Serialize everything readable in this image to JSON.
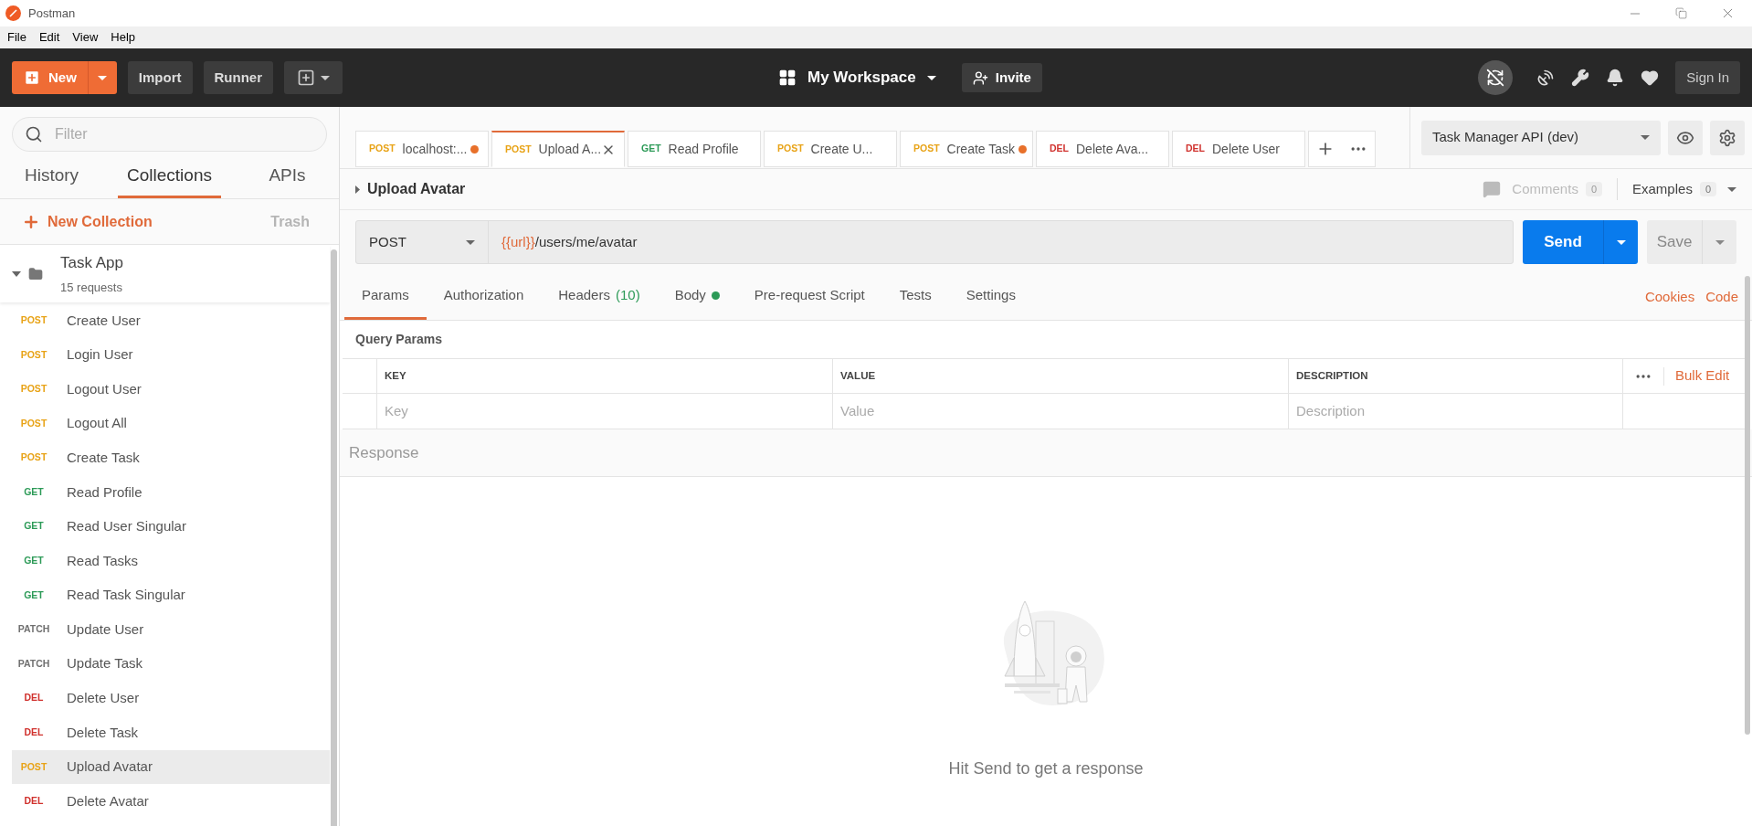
{
  "window": {
    "title": "Postman"
  },
  "menu": [
    "File",
    "Edit",
    "View",
    "Help"
  ],
  "header": {
    "new_button": "New",
    "import_button": "Import",
    "runner_button": "Runner",
    "workspace": "My Workspace",
    "invite_button": "Invite",
    "sign_in_button": "Sign In"
  },
  "sidebar": {
    "filter_placeholder": "Filter",
    "tabs": [
      {
        "label": "History",
        "selected": false
      },
      {
        "label": "Collections",
        "selected": true
      },
      {
        "label": "APIs",
        "selected": false
      }
    ],
    "new_collection": "New Collection",
    "trash": "Trash",
    "collection": {
      "name": "Task App",
      "count": "15 requests",
      "expanded": true,
      "requests": [
        {
          "method": "POST",
          "kind": "post",
          "name": "Create User",
          "selected": false
        },
        {
          "method": "POST",
          "kind": "post",
          "name": "Login User",
          "selected": false
        },
        {
          "method": "POST",
          "kind": "post",
          "name": "Logout User",
          "selected": false
        },
        {
          "method": "POST",
          "kind": "post",
          "name": "Logout All",
          "selected": false
        },
        {
          "method": "POST",
          "kind": "post",
          "name": "Create Task",
          "selected": false
        },
        {
          "method": "GET",
          "kind": "get",
          "name": "Read Profile",
          "selected": false
        },
        {
          "method": "GET",
          "kind": "get",
          "name": "Read User Singular",
          "selected": false
        },
        {
          "method": "GET",
          "kind": "get",
          "name": "Read Tasks",
          "selected": false
        },
        {
          "method": "GET",
          "kind": "get",
          "name": "Read Task Singular",
          "selected": false
        },
        {
          "method": "PATCH",
          "kind": "patch",
          "name": "Update User",
          "selected": false
        },
        {
          "method": "PATCH",
          "kind": "patch",
          "name": "Update Task",
          "selected": false
        },
        {
          "method": "DEL",
          "kind": "del",
          "name": "Delete User",
          "selected": false
        },
        {
          "method": "DEL",
          "kind": "del",
          "name": "Delete Task",
          "selected": false
        },
        {
          "method": "POST",
          "kind": "post",
          "name": "Upload Avatar",
          "selected": true
        },
        {
          "method": "DEL",
          "kind": "del",
          "name": "Delete Avatar",
          "selected": false
        }
      ]
    }
  },
  "request_tabs": [
    {
      "method": "POST",
      "kind": "post",
      "name": "localhost:...",
      "selected": false,
      "unsaved": true
    },
    {
      "method": "POST",
      "kind": "post",
      "name": "Upload A...",
      "selected": true,
      "unsaved": false
    },
    {
      "method": "GET",
      "kind": "get",
      "name": "Read Profile",
      "selected": false,
      "unsaved": false
    },
    {
      "method": "POST",
      "kind": "post",
      "name": "Create U...",
      "selected": false,
      "unsaved": false
    },
    {
      "method": "POST",
      "kind": "post",
      "name": "Create Task",
      "selected": false,
      "unsaved": true
    },
    {
      "method": "DEL",
      "kind": "del",
      "name": "Delete Ava...",
      "selected": false,
      "unsaved": false
    },
    {
      "method": "DEL",
      "kind": "del",
      "name": "Delete User",
      "selected": false,
      "unsaved": false
    }
  ],
  "environment": {
    "name": "Task Manager API (dev)"
  },
  "request": {
    "name": "Upload Avatar",
    "comments_label": "Comments",
    "comments_count": "0",
    "examples_label": "Examples",
    "examples_count": "0",
    "method": "POST",
    "url_variable": "{{url}}",
    "url_path": "/users/me/avatar",
    "send_button": "Send",
    "save_button": "Save",
    "tabs": [
      {
        "label": "Params",
        "selected": true
      },
      {
        "label": "Authorization",
        "selected": false
      },
      {
        "label": "Headers",
        "count": "(10)",
        "selected": false
      },
      {
        "label": "Body",
        "dot": true,
        "selected": false
      },
      {
        "label": "Pre-request Script",
        "selected": false
      },
      {
        "label": "Tests",
        "selected": false
      },
      {
        "label": "Settings",
        "selected": false
      }
    ],
    "links": [
      "Cookies",
      "Code"
    ],
    "params_title": "Query Params",
    "columns": [
      "KEY",
      "VALUE",
      "DESCRIPTION"
    ],
    "bulk_edit": "Bulk Edit",
    "placeholders": [
      "Key",
      "Value",
      "Description"
    ]
  },
  "response": {
    "title": "Response",
    "empty_message": "Hit Send to get a response"
  }
}
